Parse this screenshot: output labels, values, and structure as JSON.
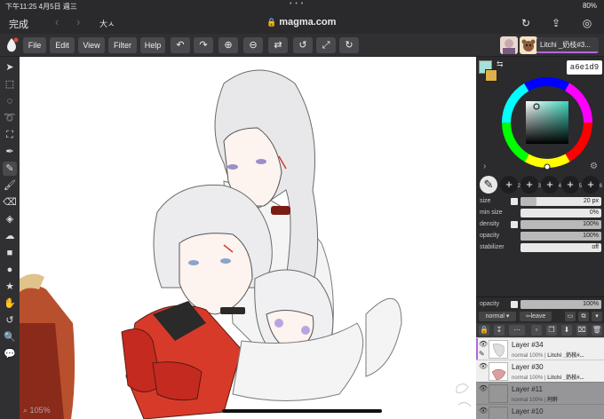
{
  "status": {
    "time": "下午11:25  4月5日 週三",
    "dots": "• • •",
    "battery": "80%"
  },
  "safari": {
    "done": "完成",
    "text_size": "大ㅅ",
    "url": "magma.com"
  },
  "toolbar": {
    "menu": [
      "File",
      "Edit",
      "View",
      "Filter",
      "Help"
    ],
    "icons": [
      "undo-icon",
      "redo-icon",
      "zoom-in-icon",
      "zoom-out-icon",
      "flip-icon",
      "rotate-icon",
      "fullscreen-icon",
      "reset-icon"
    ],
    "user_label": "Litchi _奶枝#3..."
  },
  "canvas": {
    "zoom": "105%"
  },
  "color": {
    "hex": "a6e1d9",
    "primary": "#a6e1d9",
    "secondary": "#e0b04a"
  },
  "brushes": [
    {
      "num": "1",
      "sym": "✎"
    },
    {
      "num": "2",
      "sym": "+"
    },
    {
      "num": "3",
      "sym": "+"
    },
    {
      "num": "4",
      "sym": "+"
    },
    {
      "num": "5",
      "sym": "+"
    },
    {
      "num": "6",
      "sym": "+"
    }
  ],
  "props": {
    "size": {
      "label": "size",
      "value": "20 px",
      "level": 0.2
    },
    "min_size": {
      "label": "min size",
      "value": "0%",
      "level": 0
    },
    "density": {
      "label": "density",
      "value": "100%",
      "level": 1
    },
    "opacity": {
      "label": "opacity",
      "value": "100%",
      "level": 1
    },
    "stabilizer": {
      "label": "stabilizer",
      "value": "off",
      "level": 0
    }
  },
  "layer_panel": {
    "opacity_label": "opacity",
    "opacity_value": "100%",
    "blend_mode": "normal",
    "leave_label": "leave"
  },
  "layers": [
    {
      "name": "Layer #34",
      "mode": "normal 100%",
      "owner": "Litchi _奶枝#...",
      "active": true
    },
    {
      "name": "Layer #30",
      "mode": "normal 100%",
      "owner": "Litchi _奶枝#...",
      "active": false
    },
    {
      "name": "Layer #11",
      "mode": "normal 100%",
      "owner": "阿軒",
      "active": false
    },
    {
      "name": "Layer #10",
      "mode": "",
      "owner": "",
      "active": false
    }
  ]
}
